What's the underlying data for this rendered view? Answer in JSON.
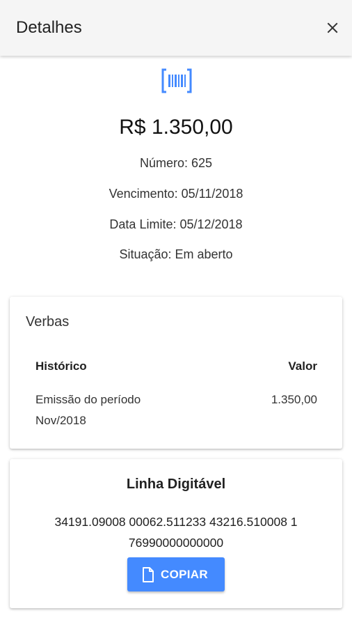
{
  "header": {
    "title": "Detalhes",
    "close_icon": "close-icon"
  },
  "summary": {
    "icon": "barcode-icon",
    "icon_color": "#448aff",
    "amount": "R$ 1.350,00",
    "numero_label": "Número:",
    "numero_value": "625",
    "vencimento_label": "Vencimento:",
    "vencimento_value": "05/11/2018",
    "data_limite_label": "Data Limite:",
    "data_limite_value": "05/12/2018",
    "situacao_label": "Situação:",
    "situacao_value": "Em aberto"
  },
  "verbas": {
    "title": "Verbas",
    "columns": [
      "Histórico",
      "Valor"
    ],
    "rows": [
      {
        "historico": "Emissão do período Nov/2018",
        "valor": "1.350,00"
      }
    ]
  },
  "linha_digitavel": {
    "title": "Linha Digitável",
    "code": "34191.09008 00062.511233 43216.510008 1 76990000000000",
    "copy_button_label": "COPIAR",
    "copy_icon": "file-icon",
    "button_color": "#448aff"
  }
}
